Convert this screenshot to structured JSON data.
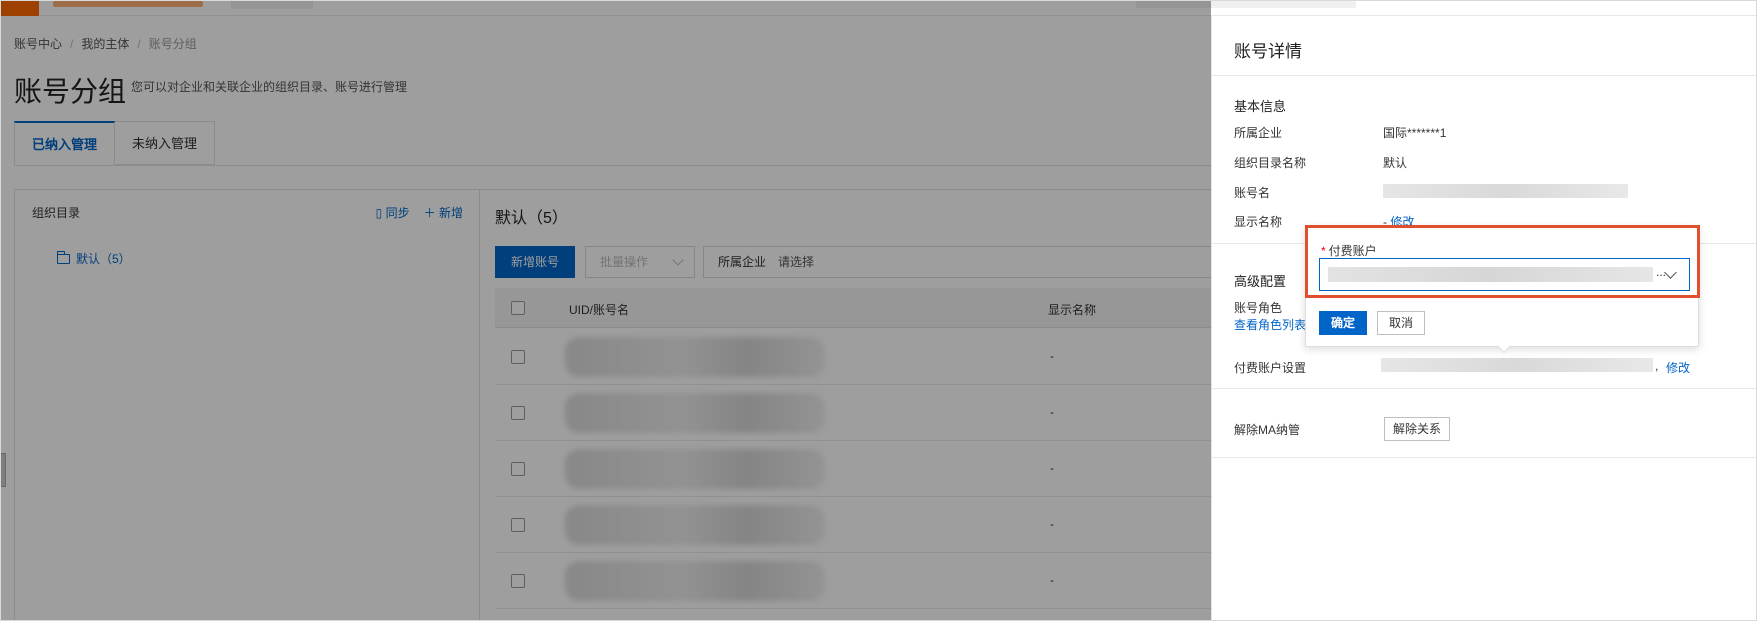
{
  "breadcrumb": {
    "items": [
      "账号中心",
      "我的主体",
      "账号分组"
    ],
    "separator": "/"
  },
  "page": {
    "title": "账号分组",
    "description": "您可以对企业和关联企业的组织目录、账号进行管理"
  },
  "tabs": [
    {
      "label": "已纳入管理",
      "active": true
    },
    {
      "label": "未纳入管理",
      "active": false
    }
  ],
  "org_panel": {
    "title": "组织目录",
    "sync_label": "同步",
    "add_label": "新增",
    "items": [
      {
        "label": "默认（5）"
      }
    ]
  },
  "list": {
    "title": "默认（5）",
    "add_account_label": "新增账号",
    "batch_label": "批量操作",
    "filter_label": "所属企业",
    "filter_placeholder": "请选择",
    "columns": [
      "UID/账号名",
      "显示名称"
    ],
    "rows": [
      {
        "display_name": "-"
      },
      {
        "display_name": "-"
      },
      {
        "display_name": "-"
      },
      {
        "display_name": "-"
      },
      {
        "display_name": "-"
      }
    ]
  },
  "drawer": {
    "title": "账号详情",
    "basic": {
      "title": "基本信息",
      "company_label": "所属企业",
      "company_value": "国际*******1",
      "dir_label": "组织目录名称",
      "dir_value": "默认",
      "account_label": "账号名",
      "display_label": "显示名称",
      "display_value": "-",
      "display_edit": "修改"
    },
    "advanced": {
      "title": "高级配置",
      "role_label": "账号角色",
      "role_link": "查看角色列表",
      "payer_label": "付费账户设置",
      "payer_edit": "修改",
      "payer_dot": ","
    },
    "unmanage": {
      "label": "解除MA纳管",
      "button": "解除关系"
    }
  },
  "popover": {
    "field_label": "付费账户",
    "required_mark": "*",
    "select_ellipsis": "...",
    "ok_label": "确定",
    "cancel_label": "取消"
  },
  "colors": {
    "primary": "#0064c8",
    "brand": "#ff6a00",
    "highlight": "#e0502f"
  }
}
